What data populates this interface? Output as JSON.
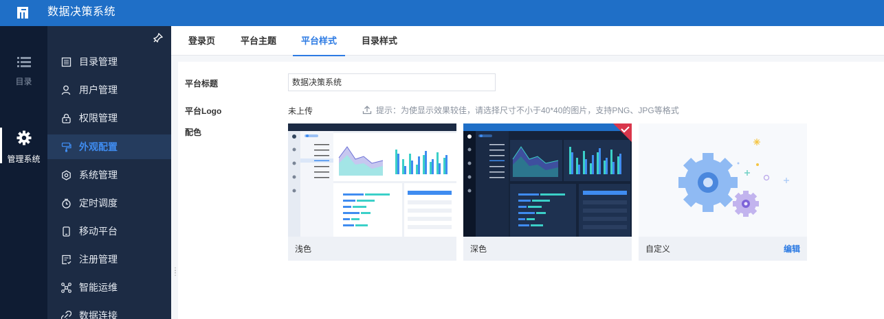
{
  "header": {
    "title": "数据决策系统",
    "logo_icon": "fanruan-logo-icon"
  },
  "rail": {
    "items": [
      {
        "label": "目录",
        "icon": "list-icon"
      },
      {
        "label": "管理系统",
        "icon": "gear-icon"
      }
    ]
  },
  "menu": {
    "items": [
      {
        "label": "目录管理",
        "icon": "catalog-icon"
      },
      {
        "label": "用户管理",
        "icon": "user-icon"
      },
      {
        "label": "权限管理",
        "icon": "lock-icon"
      },
      {
        "label": "外观配置",
        "icon": "brush-icon"
      },
      {
        "label": "系统管理",
        "icon": "settings-icon"
      },
      {
        "label": "定时调度",
        "icon": "timer-icon"
      },
      {
        "label": "移动平台",
        "icon": "mobile-icon"
      },
      {
        "label": "注册管理",
        "icon": "register-icon"
      },
      {
        "label": "智能运维",
        "icon": "ops-icon"
      },
      {
        "label": "数据连接",
        "icon": "link-icon"
      }
    ]
  },
  "tabs": [
    {
      "label": "登录页"
    },
    {
      "label": "平台主题"
    },
    {
      "label": "平台样式"
    },
    {
      "label": "目录样式"
    }
  ],
  "form": {
    "title_label": "平台标题",
    "title_value": "数据决策系统",
    "logo_label": "平台Logo",
    "logo_status": "未上传",
    "logo_hint": "提示：为使显示效果较佳，请选择尺寸不小于40*40的图片，支持PNG、JPG等格式",
    "color_label": "配色"
  },
  "themes": [
    {
      "name": "浅色"
    },
    {
      "name": "深色"
    },
    {
      "name": "自定义",
      "action": "编辑"
    }
  ],
  "colors": {
    "brand": "#1f6fc7",
    "accent": "#2d7be3",
    "rail_bg": "#0f1c33",
    "menu_bg": "#1c2b44"
  }
}
